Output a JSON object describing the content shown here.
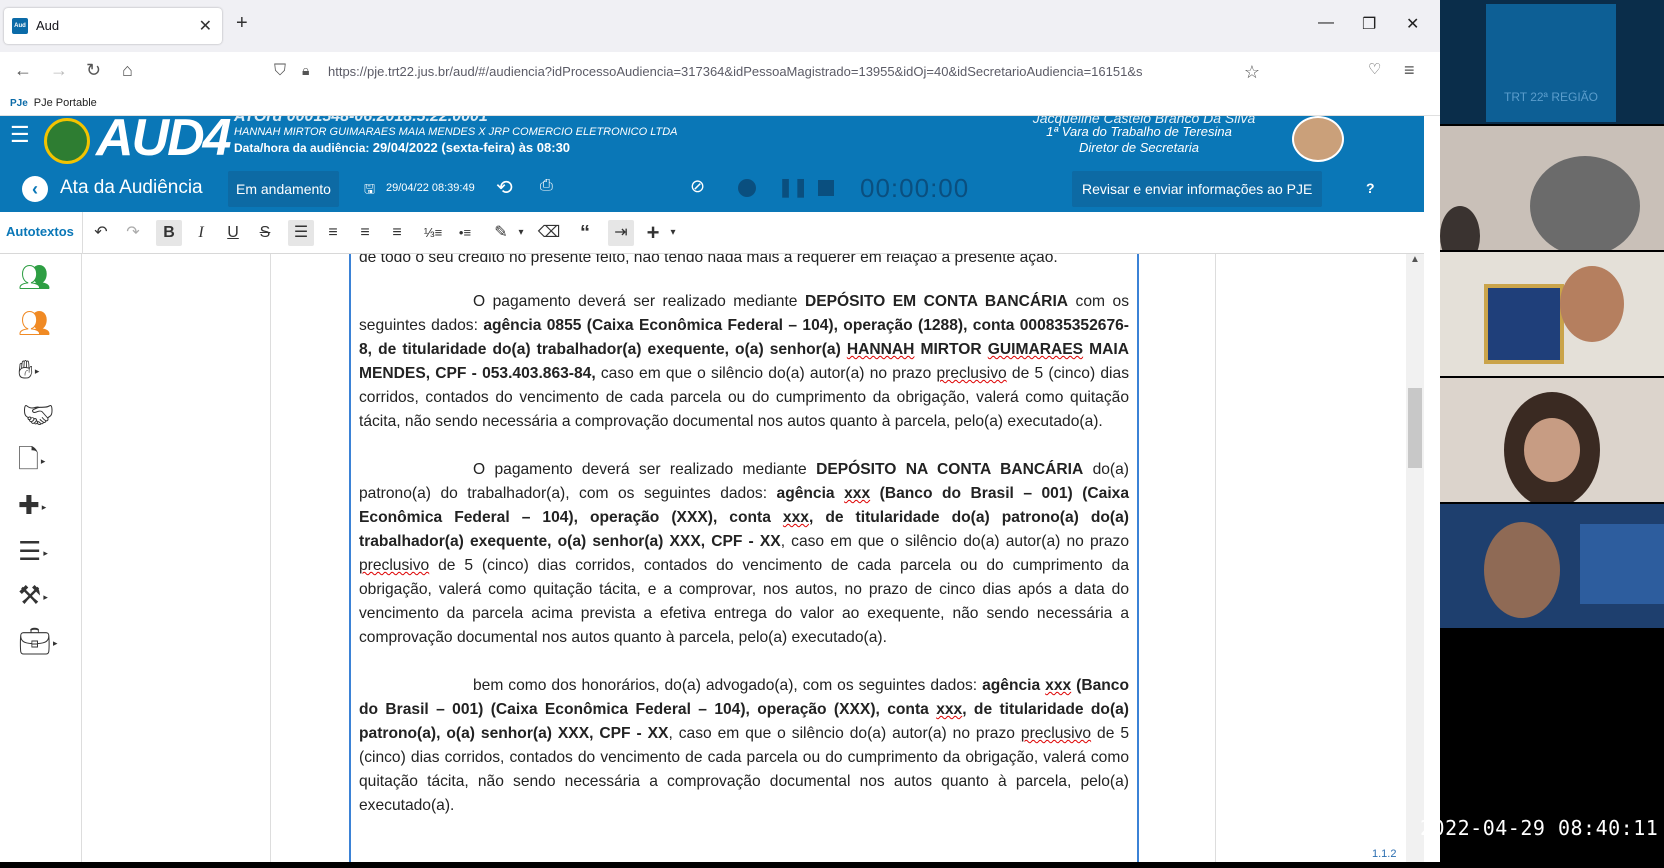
{
  "browser": {
    "tab_title": "Aud",
    "url": "https://pje.trt22.jus.br/aud/#/audiencia?idProcessoAudiencia=317364&idPessoaMagistrado=13955&idOj=40&idSecretarioAudiencia=16151&s",
    "bookmark": "PJe Portable",
    "bookmark_prefix": "PJe"
  },
  "app": {
    "logo": "AUD4",
    "process_number": "ATOrd 0001548-06.2018.5.22.0001",
    "parties": "HANNAH MIRTOR GUIMARAES MAIA MENDES X JRP COMERCIO ELETRONICO LTDA",
    "hearing_date_label": "Data/hora da audiência:",
    "hearing_date": "29/04/2022 (sexta-feira) às 08:30",
    "user_name": "Jacqueline Castelo Branco Da Silva",
    "court": "1ª Vara do Trabalho de Teresina",
    "user_role": "Diretor de Secretaria"
  },
  "subheader": {
    "page_title": "Ata da Audiência",
    "status": "Em andamento",
    "save_time": "29/04/22 08:39:49",
    "timer": "00:00:00",
    "review_button": "Revisar e enviar informações ao PJE",
    "help": "?"
  },
  "toolbar": {
    "autotextos": "Autotextos"
  },
  "document": {
    "p0": "de todo o seu crédito no presente feito, não tendo nada mais a requerer em relação à presente ação.",
    "p1a": "O pagamento deverá ser realizado mediante ",
    "p1b": "DEPÓSITO EM CONTA BANCÁRIA",
    "p1c": " com os seguintes dados: ",
    "p1d": "agência 0855 (Caixa Econômica Federal – 104), operação (1288), conta 000835352676-8, de titularidade do(a) trabalhador(a) exequente, o(a) senhor(a) ",
    "p1e": "HANNAH",
    "p1f": " MIRTOR ",
    "p1g": "GUIMARAES",
    "p1h": " MAIA MENDES, CPF - 053.403.863-84,",
    "p1i": " caso em que o silêncio do(a) autor(a) no prazo ",
    "p1j": "preclusivo",
    "p1k": " de 5 (cinco) dias corridos, contados do vencimento de cada parcela ou do cumprimento da obrigação, valerá como quitação tácita, não sendo necessária a comprovação documental nos autos quanto à parcela, pelo(a) executado(a).",
    "p2a": "O pagamento deverá ser realizado mediante ",
    "p2b": "DEPÓSITO NA CONTA BANCÁRIA",
    "p2c": " do(a) patrono(a) do trabalhador(a), com os seguintes dados: ",
    "p2d": "agência ",
    "p2e": "xxx",
    "p2f": " (Banco do Brasil – 001) (Caixa Econômica Federal – 104), operação (XXX), conta ",
    "p2g": "xxx",
    "p2h": ", de titularidade do(a) patrono(a) do(a) trabalhador(a) exequente, o(a) senhor(a) XXX, CPF - XX",
    "p2i": ", caso em que o silêncio do(a) autor(a) no prazo ",
    "p2j": "preclusivo",
    "p2k": " de 5 (cinco) dias corridos, contados do vencimento de cada parcela ou do cumprimento da obrigação, valerá como quitação tácita, e a comprovar, nos autos, no prazo de cinco dias após a data do vencimento da parcela acima prevista a efetiva entrega do valor ao exequente, não sendo necessária a comprovação documental nos autos quanto à parcela, pelo(a) executado(a).",
    "p3a": "bem como dos honorários, do(a) advogado(a), com os seguintes dados: ",
    "p3b": "agência ",
    "p3c": "xxx",
    "p3d": " (Banco do Brasil – 001) (Caixa Econômica Federal – 104), operação (XXX), conta ",
    "p3e": "xxx",
    "p3f": ", de titularidade do(a) patrono(a), o(a) senhor(a) XXX, CPF - XX",
    "p3g": ", caso em que o silêncio do(a) autor(a) no prazo ",
    "p3h": "preclusivo",
    "p3i": " de 5 (cinco) dias corridos, contados do vencimento de cada parcela ou do cumprimento da obrigação, valerá como quitação tácita, não sendo necessária a comprovação documental nos autos quanto à parcela, pelo(a) executado(a)."
  },
  "version": "1.1.2",
  "video": {
    "top_watermark": "TRT 22ª REGIÃO",
    "timestamp": "2022-04-29 08:40:11"
  },
  "colors": {
    "brand_blue": "#0a77b7",
    "accent_green": "#2e9e43",
    "accent_orange": "#f08a24"
  }
}
